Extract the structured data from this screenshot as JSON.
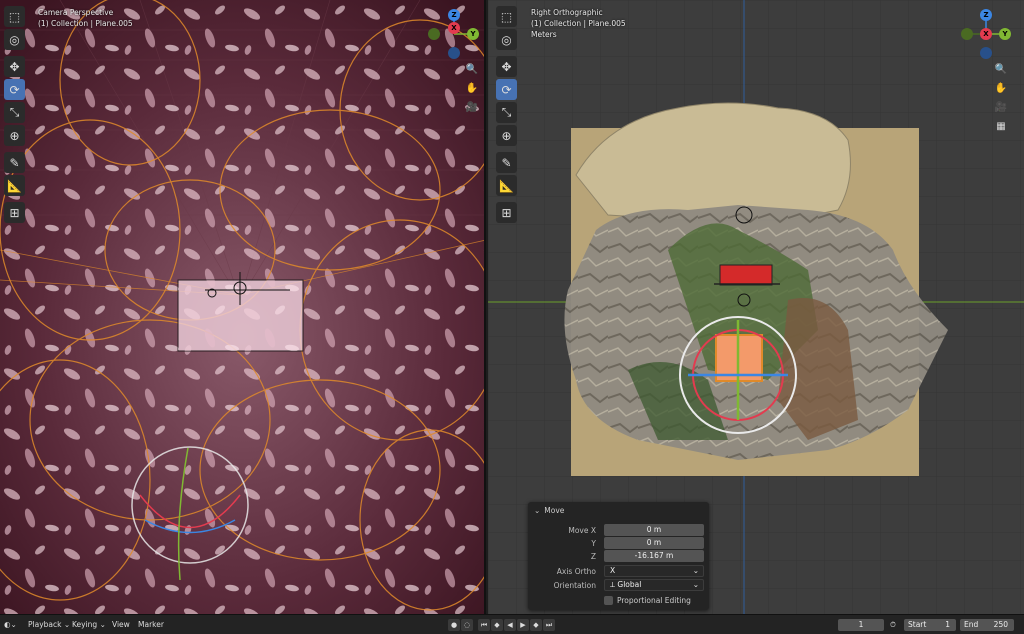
{
  "left_viewport": {
    "view_name": "Camera Perspective",
    "collection_info": "(1) Collection | Plane.005"
  },
  "right_viewport": {
    "view_name": "Right Orthographic",
    "collection_info": "(1) Collection | Plane.005",
    "units": "Meters"
  },
  "gizmo": {
    "z": "Z",
    "x": "X",
    "y": "Y",
    "colors": {
      "x": "#e33b4f",
      "y": "#80b833",
      "z": "#3b86e3"
    }
  },
  "tools": [
    "select-box",
    "cursor",
    "move",
    "rotate",
    "scale",
    "transform",
    "annotate",
    "measure",
    "add-cube"
  ],
  "move_panel": {
    "title": "Move",
    "move_x_label": "Move X",
    "move_x_value": "0 m",
    "y_label": "Y",
    "y_value": "0 m",
    "z_label": "Z",
    "z_value": "-16.167 m",
    "axis_ortho_label": "Axis Ortho",
    "axis_ortho_value": "X",
    "orientation_label": "Orientation",
    "orientation_value": "Global",
    "proportional_label": "Proportional Editing"
  },
  "timeline": {
    "playback": "Playback",
    "keying": "Keying",
    "view": "View",
    "marker": "Marker",
    "current_frame": "1",
    "start_label": "Start",
    "start_value": "1",
    "end_label": "End",
    "end_value": "250"
  },
  "colors": {
    "accent": "#4772b3",
    "selection_orange": "#e08a2a"
  }
}
